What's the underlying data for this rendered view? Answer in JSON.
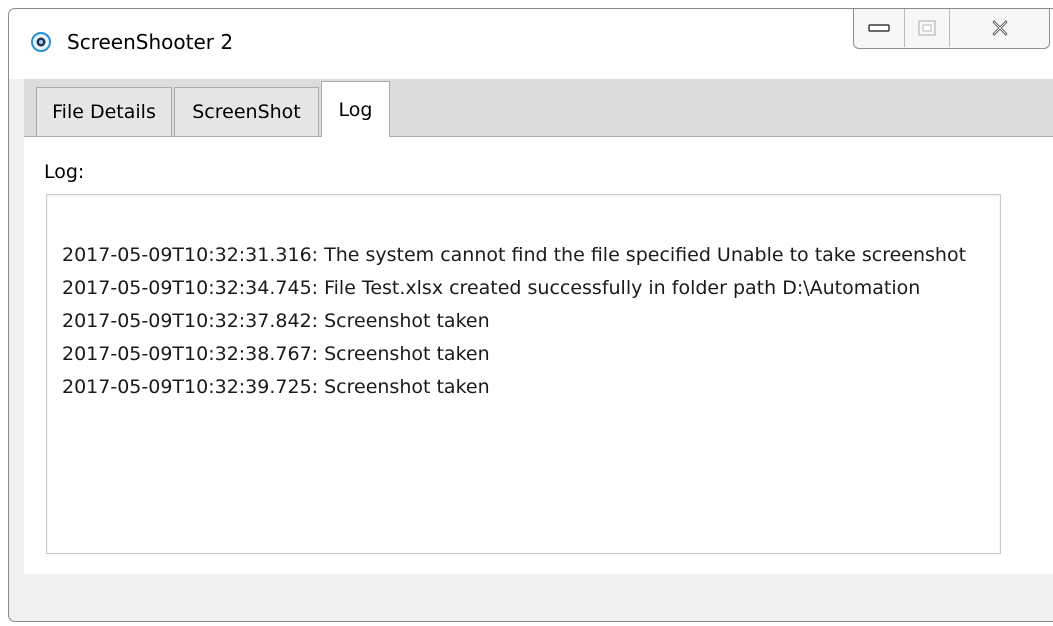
{
  "window": {
    "title": "ScreenShooter 2",
    "icon": "camera-lens-icon",
    "caption_buttons": {
      "minimize_icon": "minimize-icon",
      "maximize_icon": "maximize-icon",
      "close_icon": "close-icon"
    }
  },
  "tabs": [
    {
      "label": "File Details",
      "active": false
    },
    {
      "label": "ScreenShot",
      "active": false
    },
    {
      "label": "Log",
      "active": true
    }
  ],
  "log": {
    "label": "Log:",
    "lines": [
      "2017-05-09T10:32:31.316: The system cannot find the file specified Unable to take screenshot",
      "2017-05-09T10:32:34.745: File Test.xlsx created successfully in folder path D:\\Automation",
      "2017-05-09T10:32:37.842: Screenshot taken",
      "2017-05-09T10:32:38.767: Screenshot taken",
      "2017-05-09T10:32:39.725: Screenshot taken"
    ]
  },
  "colors": {
    "accent": "#2b8fd6",
    "window_background": "#f0f0f0",
    "tabbar_background": "#dcdcdc"
  }
}
